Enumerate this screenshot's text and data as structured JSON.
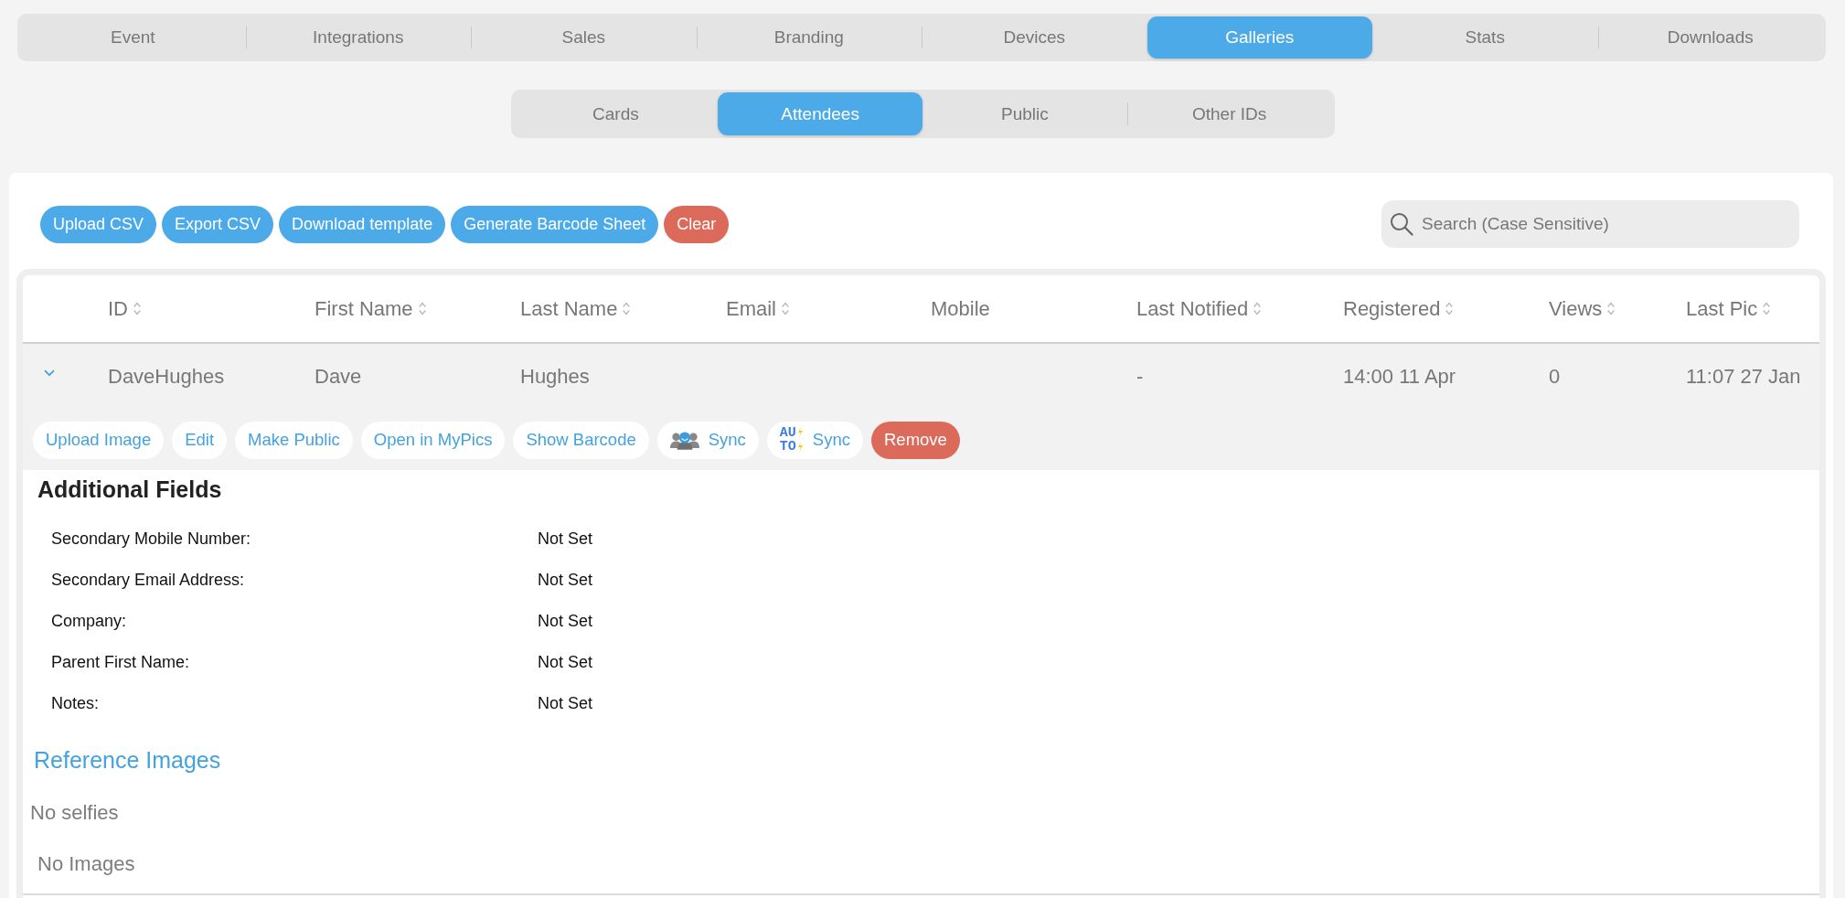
{
  "main_tabs": [
    {
      "label": "Event",
      "selected": false
    },
    {
      "label": "Integrations",
      "selected": false
    },
    {
      "label": "Sales",
      "selected": false
    },
    {
      "label": "Branding",
      "selected": false
    },
    {
      "label": "Devices",
      "selected": false
    },
    {
      "label": "Galleries",
      "selected": true
    },
    {
      "label": "Stats",
      "selected": false
    },
    {
      "label": "Downloads",
      "selected": false
    }
  ],
  "sub_tabs": [
    {
      "label": "Cards",
      "selected": false
    },
    {
      "label": "Attendees",
      "selected": true
    },
    {
      "label": "Public",
      "selected": false
    },
    {
      "label": "Other IDs",
      "selected": false
    }
  ],
  "toolbar": {
    "buttons": [
      {
        "label": "Upload CSV",
        "kind": "primary"
      },
      {
        "label": "Export CSV",
        "kind": "primary"
      },
      {
        "label": "Download template",
        "kind": "primary"
      },
      {
        "label": "Generate Barcode Sheet",
        "kind": "primary"
      },
      {
        "label": "Clear",
        "kind": "danger"
      }
    ],
    "search": {
      "placeholder": "Search (Case Sensitive)"
    }
  },
  "table": {
    "columns": [
      {
        "label": "ID",
        "sortable": true
      },
      {
        "label": "First Name",
        "sortable": true
      },
      {
        "label": "Last Name",
        "sortable": true
      },
      {
        "label": "Email",
        "sortable": true
      },
      {
        "label": "Mobile",
        "sortable": false
      },
      {
        "label": "Last Notified",
        "sortable": true
      },
      {
        "label": "Registered",
        "sortable": true
      },
      {
        "label": "Views",
        "sortable": true
      },
      {
        "label": "Last Pic",
        "sortable": true
      }
    ],
    "rows": [
      {
        "expanded": true,
        "cells": [
          "DaveHughes",
          "Dave",
          "Hughes",
          null,
          null,
          "-",
          "14:00 11 Apr",
          "0",
          "11:07 27 Jan"
        ],
        "actions": [
          {
            "label": "Upload Image",
            "kind": "link"
          },
          {
            "label": "Edit",
            "kind": "link"
          },
          {
            "label": "Make Public",
            "kind": "link"
          },
          {
            "label": "Open in MyPics",
            "kind": "link"
          },
          {
            "label": "Show Barcode",
            "kind": "link"
          },
          {
            "label": "Sync",
            "kind": "group_sync"
          },
          {
            "label": "Sync",
            "kind": "auto_sync",
            "badge": "AUTO"
          },
          {
            "label": "Remove",
            "kind": "danger"
          }
        ],
        "details": {
          "title": "Additional Fields",
          "fields": [
            {
              "label": "Secondary Mobile Number:",
              "value": "Not Set"
            },
            {
              "label": "Secondary Email Address:",
              "value": "Not Set"
            },
            {
              "label": "Company:",
              "value": "Not Set"
            },
            {
              "label": "Parent First Name:",
              "value": "Not Set"
            },
            {
              "label": "Notes:",
              "value": "Not Set"
            }
          ],
          "reference_title": "Reference Images",
          "selfies_text": "No selfies",
          "images_text": "No Images"
        }
      }
    ]
  }
}
